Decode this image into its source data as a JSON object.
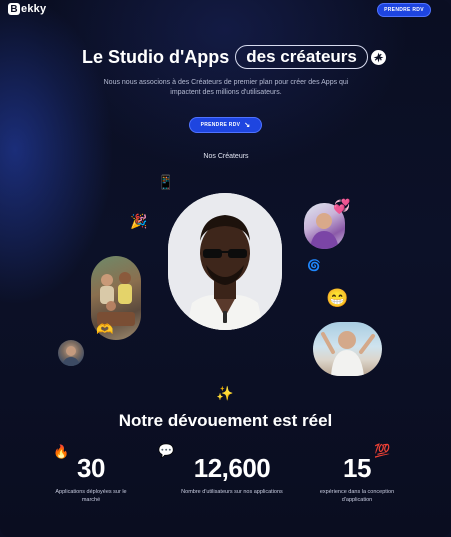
{
  "nav": {
    "logo_letter": "B",
    "logo_text": "ekky",
    "cta_label": "PRENDRE RDV"
  },
  "hero": {
    "title_part1": "Le Studio d'Apps",
    "title_highlight": "des créateurs",
    "subtitle": "Nous nous associons à des Créateurs de premier plan pour créer des Apps qui impactent des millions d'utilisateurs.",
    "cta_label": "PRENDRE RDV"
  },
  "creators": {
    "title": "Nos Créateurs",
    "emojis": [
      "📱",
      "🎉",
      "🫶",
      "🌀",
      "😁",
      "✨"
    ]
  },
  "stats": {
    "title": "Notre dévouement est réel",
    "items": [
      {
        "value": "30",
        "label": "Applications déployées sur le marché",
        "icon": "🔥"
      },
      {
        "value": "12,600",
        "label": "Nombre d'utilisateurs sur nos applications",
        "icon": "💬"
      },
      {
        "value": "15",
        "label": "expérience dans la conception d'application",
        "icon": "💯"
      }
    ]
  },
  "colors": {
    "background": "#0b0f24",
    "accent": "#1e45e0"
  }
}
